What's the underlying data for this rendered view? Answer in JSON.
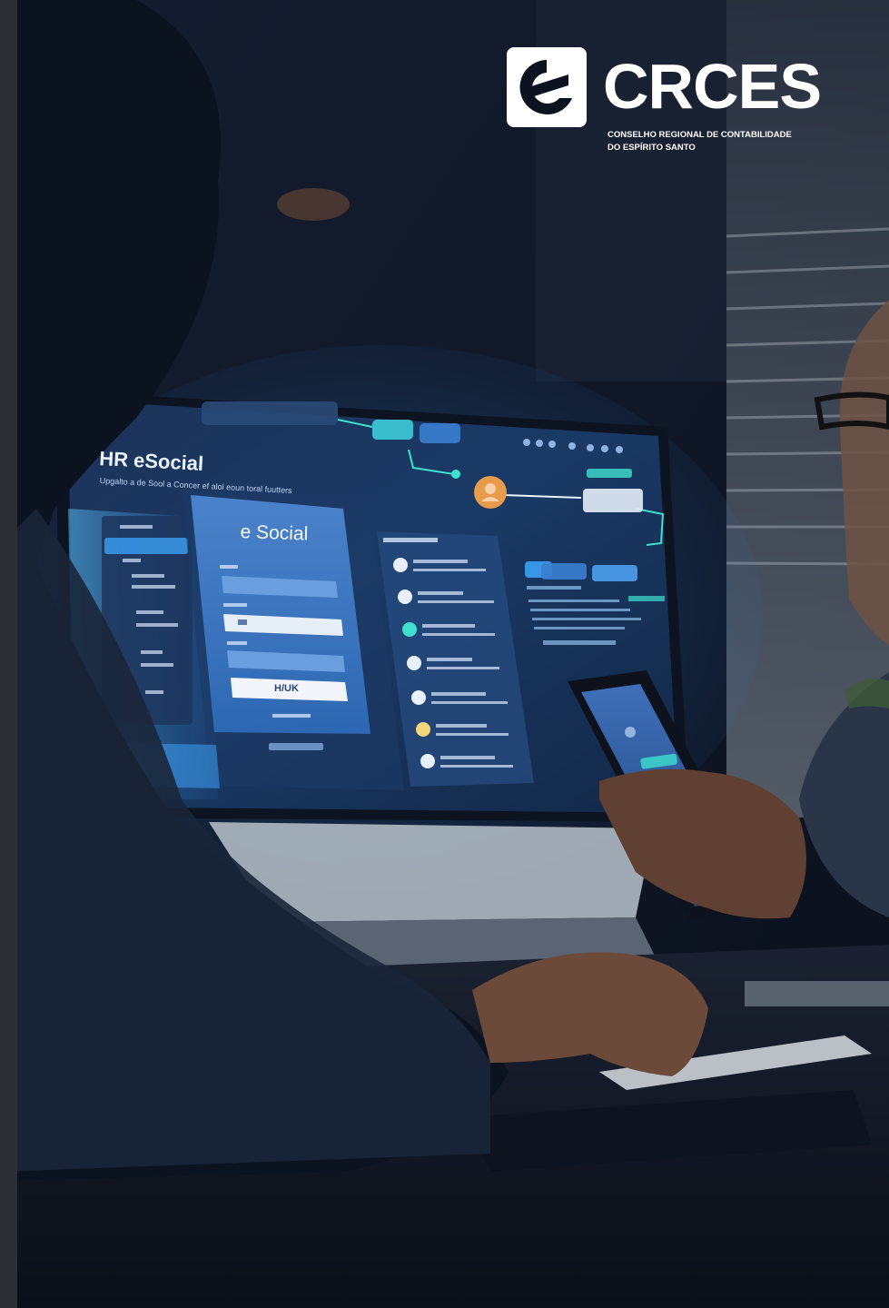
{
  "brand": {
    "name": "CRCES",
    "subtitle_line1": "CONSELHO REGIONAL DE CONTABILIDADE",
    "subtitle_line2": "DO ESPÍRITO SANTO",
    "color": "#ffffff"
  },
  "screen": {
    "title": "HR eSocial",
    "subtitle": "Upgalto a de Sool a Concer ef alol eoun toral fuutters",
    "login_card_title": "e Social",
    "login_button": "H/UK"
  },
  "colors": {
    "background": "#0c1220",
    "screen_glow": "#3aa0ff",
    "accent_orange": "#e89b4a",
    "accent_teal": "#3fe0d0"
  }
}
